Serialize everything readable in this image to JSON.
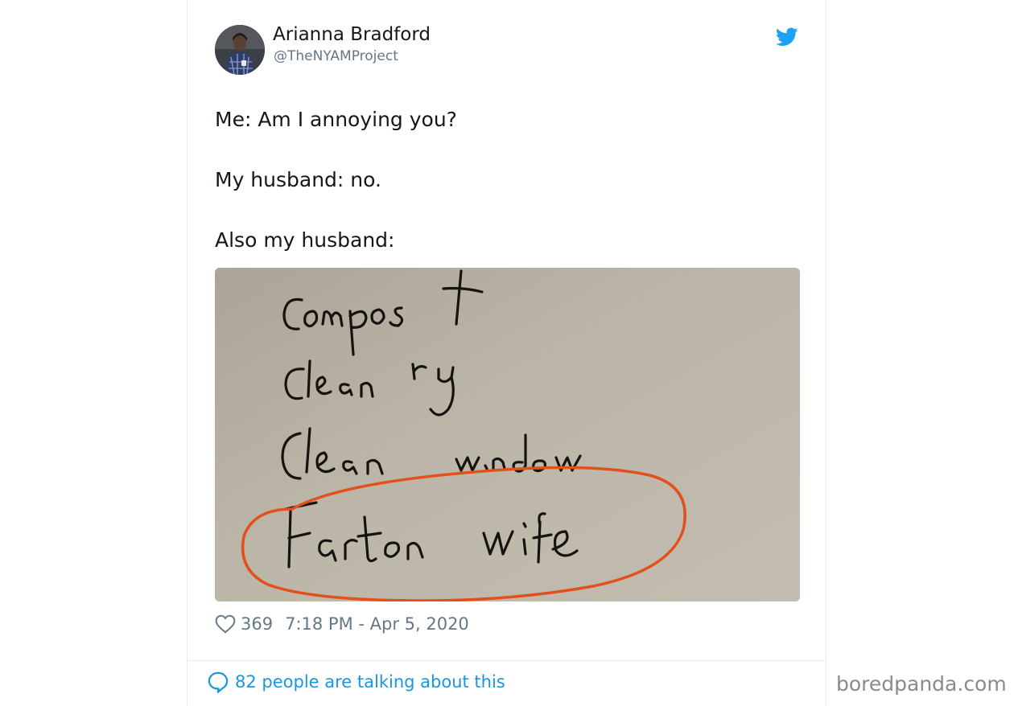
{
  "author": {
    "name": "Arianna Bradford",
    "handle": "@TheNYAMProject",
    "avatar_icon": "avatar-photo"
  },
  "platform_icon": "twitter-bird-icon",
  "tweet": {
    "lines": [
      "Me: Am I annoying you?",
      "My husband: no.",
      "Also my husband:"
    ]
  },
  "media": {
    "handwritten_note": "Compost / Clean rug / Clean window / Fart on wife (circled in orange)"
  },
  "meta": {
    "like_count": "369",
    "timestamp": "7:18 PM - Apr 5, 2020"
  },
  "footer": {
    "talking_text": "82 people are talking about this"
  },
  "watermark": "boredpanda.com",
  "colors": {
    "text": "#14171a",
    "secondary": "#657786",
    "link": "#1b95e0",
    "twitter_blue": "#1da1f2",
    "circle_annotation": "#e2511c"
  }
}
